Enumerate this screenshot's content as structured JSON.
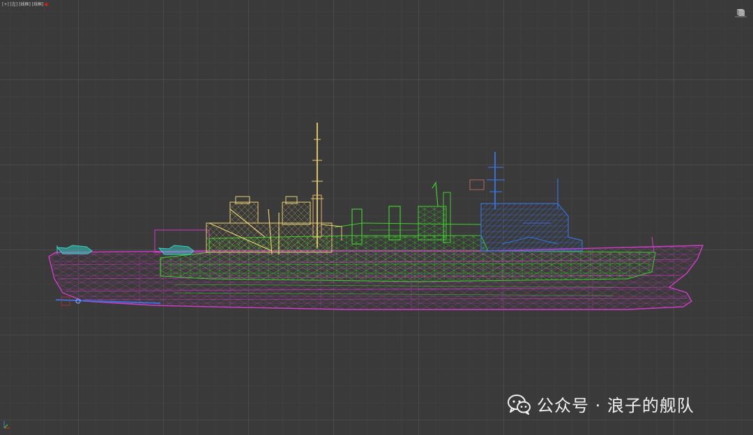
{
  "viewport": {
    "label": "[+] [左] [线框] [线框]",
    "background": "#3a3a3a"
  },
  "model": {
    "colors": {
      "hull": "#d23cc8",
      "midship": "#3fcf2a",
      "superstructure": "#e8d070",
      "bridge": "#3a6fd8",
      "helicopter": "#35d5c8"
    },
    "icons": [
      "viewcube-icon",
      "axis-tripod-icon"
    ]
  },
  "watermark": {
    "icon": "wechat-icon",
    "text": "公众号 · 浪子的舰队"
  }
}
